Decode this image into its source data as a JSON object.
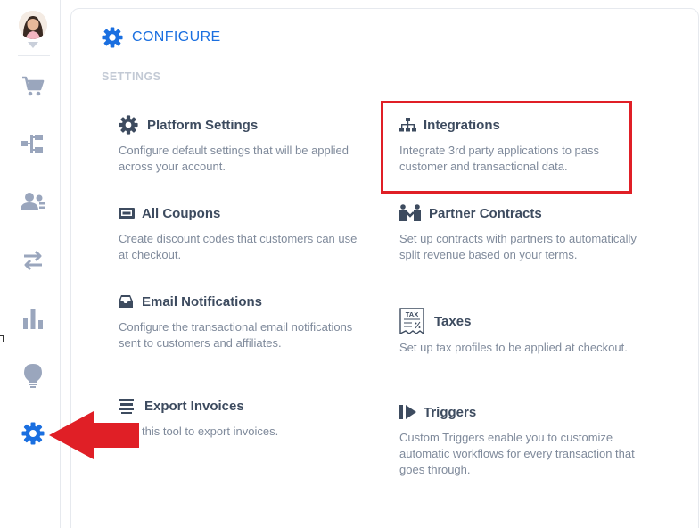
{
  "sidebar": {
    "items": [
      {
        "name": "cart",
        "icon": "cart-icon"
      },
      {
        "name": "funnel",
        "icon": "flow-icon"
      },
      {
        "name": "contacts",
        "icon": "users-icon"
      },
      {
        "name": "transfers",
        "icon": "arrows-icon"
      },
      {
        "name": "reports",
        "icon": "bar-chart-icon"
      },
      {
        "name": "ideas",
        "icon": "lightbulb-icon"
      },
      {
        "name": "configure",
        "icon": "gear-icon",
        "active": true
      }
    ]
  },
  "header": {
    "title": "CONFIGURE",
    "icon": "gear-icon"
  },
  "section": {
    "label": "SETTINGS"
  },
  "cards": {
    "platform": {
      "title": "Platform Settings",
      "desc": "Configure default settings that will be applied across your account.",
      "icon": "gear-icon"
    },
    "integrations": {
      "title": "Integrations",
      "desc": "Integrate 3rd party applications to pass customer and transactional data.",
      "icon": "sitemap-icon"
    },
    "coupons": {
      "title": "All Coupons",
      "desc": "Create discount codes that customers can use at checkout.",
      "icon": "ticket-icon"
    },
    "partners": {
      "title": "Partner Contracts",
      "desc": "Set up contracts with partners to automatically split revenue based on your terms.",
      "icon": "partners-icon"
    },
    "email": {
      "title": "Email Notifications",
      "desc": "Configure the transactional email notifications sent to customers and affiliates.",
      "icon": "inbox-icon"
    },
    "taxes": {
      "title": "Taxes",
      "desc": "Set up tax profiles to be applied at checkout.",
      "icon": "tax-icon",
      "icon_text": "TAX"
    },
    "export": {
      "title": "Export Invoices",
      "desc": "this tool to export invoices.",
      "icon": "layers-icon"
    },
    "triggers": {
      "title": "Triggers",
      "desc": "Custom Triggers enable you to customize automatic workflows for every transaction that goes through.",
      "icon": "triggers-icon"
    }
  },
  "colors": {
    "accent": "#1a6fe0",
    "nav_icon": "#9aa6bd",
    "annotation": "#e01f26",
    "title_text": "#3d4b5f",
    "desc_text": "#7f8a9b"
  }
}
